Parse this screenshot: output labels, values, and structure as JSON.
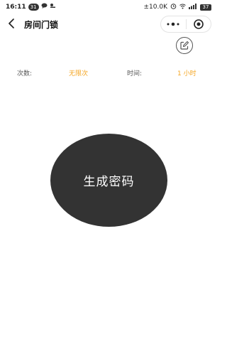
{
  "status_bar": {
    "time": "16:11",
    "notification_count": "31",
    "network_speed": "10.0K",
    "battery": "37"
  },
  "nav": {
    "title": "房间门锁"
  },
  "info": {
    "count_label": "次数:",
    "count_value": "无限次",
    "time_label": "时间:",
    "time_value": "1 小时"
  },
  "main": {
    "generate_label": "生成密码"
  },
  "colors": {
    "accent": "#f5a623",
    "button_bg": "#333333",
    "background": "#ffffff"
  },
  "icons": {
    "back": "back-icon",
    "more": "more-dots-icon",
    "close": "target-close-icon",
    "edit": "edit-icon"
  }
}
